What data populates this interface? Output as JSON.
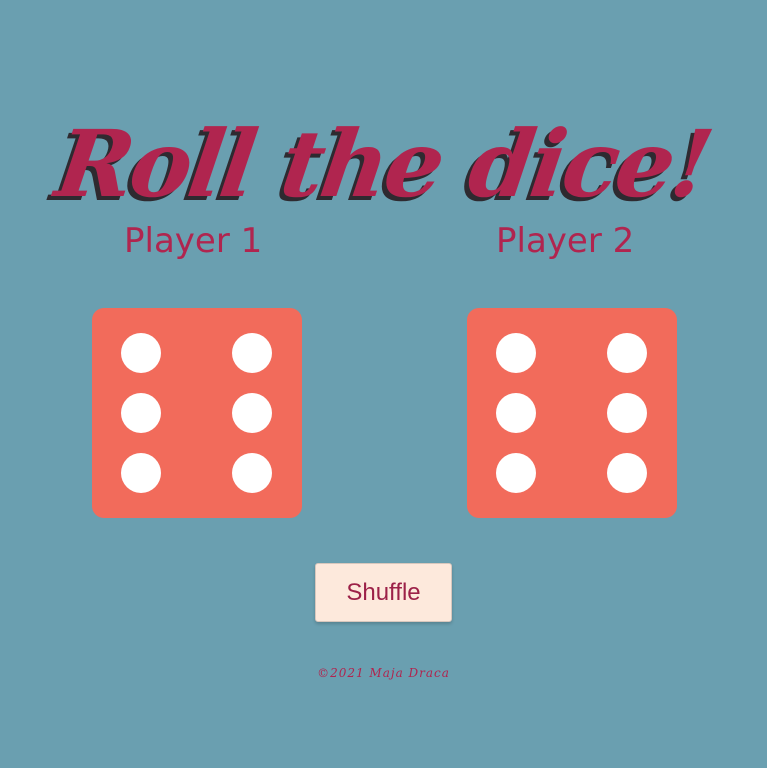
{
  "page": {
    "title": "Roll the dice!",
    "background": "#6a9fb0",
    "accent": "#b0254f"
  },
  "players": [
    {
      "label": "Player 1",
      "die_value": 6
    },
    {
      "label": "Player 2",
      "die_value": 6
    }
  ],
  "dice_colors": {
    "face": "#f26b5b",
    "pip": "#ffffff"
  },
  "controls": {
    "shuffle_label": "Shuffle"
  },
  "footer": {
    "text": "©2021 Maja Draca"
  }
}
